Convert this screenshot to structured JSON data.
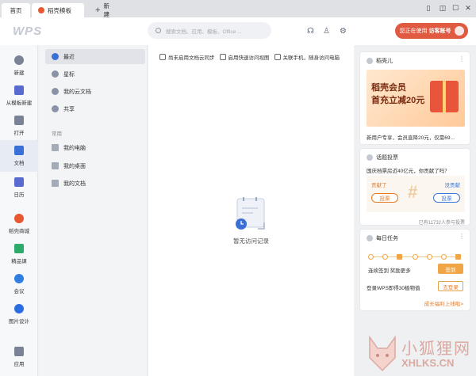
{
  "tabs": [
    {
      "label": "首页"
    },
    {
      "label": "稻壳模板"
    },
    {
      "label": "新建"
    }
  ],
  "header": {
    "logo": "WPS",
    "search_placeholder": "搜索文档、应用、模板、Office ...",
    "user_btn_prefix": "您正在使用",
    "user_btn_name": "访客账号"
  },
  "sidebar": [
    {
      "label": "新建",
      "icon": "plus-icon",
      "color": "#7a8396"
    },
    {
      "label": "从模板新建",
      "icon": "template-icon",
      "color": "#5a6bd0"
    },
    {
      "label": "打开",
      "icon": "folder-icon",
      "color": "#7a8396"
    },
    {
      "label": "文档",
      "icon": "document-icon",
      "color": "#3b6fd8"
    },
    {
      "label": "日历",
      "icon": "calendar-icon",
      "color": "#5a6bd0"
    },
    {
      "label": "稻壳商城",
      "icon": "shop-icon",
      "color": "#e8572f"
    },
    {
      "label": "精品课",
      "icon": "course-icon",
      "color": "#2eaa6a"
    },
    {
      "label": "会议",
      "icon": "meeting-icon",
      "color": "#2f7ee0"
    },
    {
      "label": "图片设计",
      "icon": "image-design-icon",
      "color": "#2b6ce0"
    },
    {
      "label": "应用",
      "icon": "apps-icon",
      "color": "#7a8396"
    }
  ],
  "subnav": {
    "items": [
      {
        "label": "最近",
        "icon": "clock-icon",
        "color": "#3b6fd8"
      },
      {
        "label": "星标",
        "icon": "star-icon",
        "color": "#8a93a6"
      },
      {
        "label": "我的云文档",
        "icon": "cloud-icon",
        "color": "#8a93a6"
      },
      {
        "label": "共享",
        "icon": "share-icon",
        "color": "#8a93a6"
      }
    ],
    "common_label": "常用",
    "common_items": [
      {
        "label": "我的电脑",
        "icon": "computer-icon"
      },
      {
        "label": "我的桌面",
        "icon": "desktop-icon"
      },
      {
        "label": "我的文档",
        "icon": "folder-icon"
      }
    ]
  },
  "toolbar": {
    "items": [
      {
        "label": "尚未启用文档云同步",
        "icon": "cloud-sync-icon"
      },
      {
        "label": "启用快速访问视图",
        "icon": "send-icon"
      },
      {
        "label": "关联手机，随身访问电脑",
        "icon": "phone-icon"
      }
    ]
  },
  "empty_state": {
    "text": "暂无访问记录"
  },
  "cards": {
    "daoke": {
      "title": "稻壳儿",
      "promo_line1": "稻壳会员",
      "promo_line2": "首充立减20元",
      "desc": "新用户专享，会员直降20元，仅需69..."
    },
    "vote": {
      "title": "话题投票",
      "question": "国庆档票房近40亿元，你贡献了吗？",
      "option_a": "贡献了",
      "option_b": "没贡献",
      "vote_label": "投票",
      "count": "已有11732人参与投票"
    },
    "tasks": {
      "title": "每日任务",
      "streak": "连续签到 奖励更多",
      "sign_in": "签到",
      "task": "登录WPS即得30植物值",
      "go_login": "去登录",
      "growth_link": "成长福利上线啦>"
    }
  },
  "watermark": {
    "cn": "小狐狸网",
    "en": "XHLKS.CN"
  }
}
